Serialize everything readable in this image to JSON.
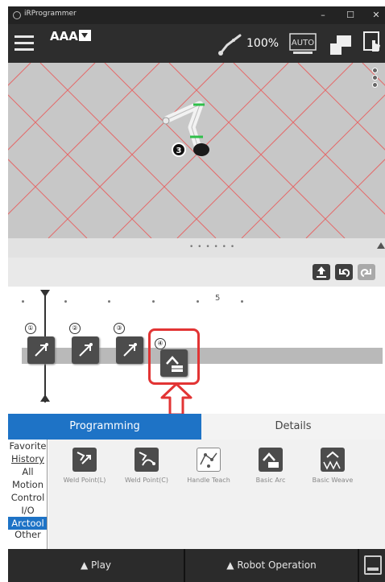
{
  "window": {
    "title": "iRProgrammer",
    "minimize": "–",
    "maximize": "☐",
    "close": "✕"
  },
  "toolbar": {
    "program_name": "AAA",
    "speed": "100%",
    "auto_label": "AUTO"
  },
  "timeline": {
    "scale_label": "5",
    "commands": [
      {
        "badge": "①"
      },
      {
        "badge": "②"
      },
      {
        "badge": "③"
      },
      {
        "badge": "④"
      }
    ],
    "view_badge": "3"
  },
  "tabs": {
    "programming": "Programming",
    "details": "Details"
  },
  "categories": [
    "Favorite",
    "History",
    "All",
    "Motion",
    "Control",
    "I/O",
    "Arctool",
    "Other"
  ],
  "selected_category": "Arctool",
  "palette": [
    {
      "label": "Weld Point(L)"
    },
    {
      "label": "Weld Point(C)"
    },
    {
      "label": "Handle Teach"
    },
    {
      "label": "Basic Arc"
    },
    {
      "label": "Basic Weave"
    }
  ],
  "bottom": {
    "play": "▲ Play",
    "robot_operation": "▲ Robot Operation"
  },
  "colors": {
    "accent": "#1e73c6",
    "highlight": "#e23434",
    "grid_line": "#e46a6a"
  }
}
